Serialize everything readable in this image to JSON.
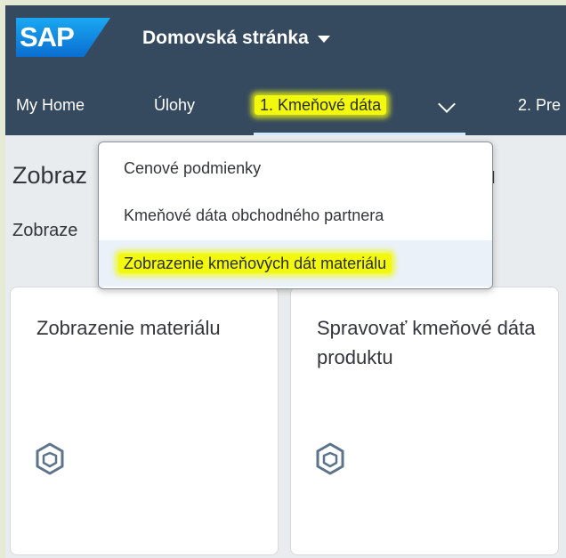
{
  "shell": {
    "logo": "SAP",
    "title": "Domovská stránka"
  },
  "tabs": [
    {
      "label": "My Home"
    },
    {
      "label": "Úlohy"
    },
    {
      "label": "1. Kmeňové dáta"
    },
    {
      "label": "2. Pre"
    }
  ],
  "dropdown": {
    "items": [
      {
        "label": "Cenové podmienky"
      },
      {
        "label": "Kmeňové dáta obchodného partnera"
      },
      {
        "label": "Zobrazenie kmeňových dát materiálu"
      }
    ]
  },
  "page": {
    "section_title": "Zobraz",
    "section_title_tail": "u",
    "group_title": "Zobraze"
  },
  "tiles": [
    {
      "title": "Zobrazenie materiálu",
      "icon": "cube-icon"
    },
    {
      "title": "Spravovať kmeňové dáta produktu",
      "icon": "cube-icon"
    }
  ],
  "colors": {
    "shell": "#354a5f",
    "highlight": "#f2f90d",
    "content_bg": "#e9ecee"
  }
}
